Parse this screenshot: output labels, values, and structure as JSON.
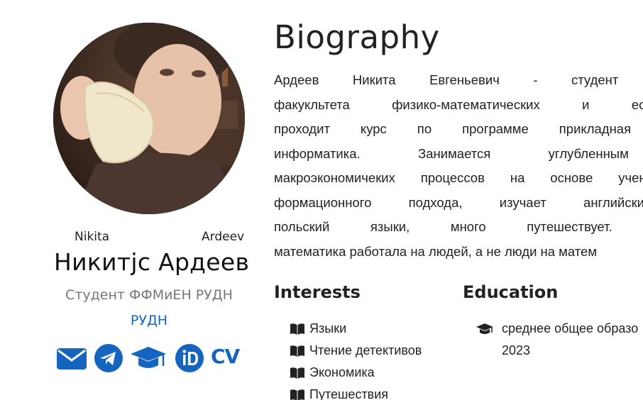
{
  "profile": {
    "first_name": "Nikita",
    "last_name": "Ardeev",
    "full_name": "Никитјс Ардеев",
    "role": "Студент ФФМиЕН РУДН",
    "organization": "РУДН",
    "cv_label": "CV",
    "icons": [
      "envelope-icon",
      "telegram-icon",
      "graduation-cap-icon",
      "orcid-icon"
    ],
    "accent_color": "#1565c0"
  },
  "biography": {
    "title": "Biography",
    "lines": [
      "Ардеев Никита Евгеньевич - студент первого",
      "факукльтета физико-математических и естественн",
      "проходит курс по программе прикладная матем",
      "информатика. Занимается углубленным из",
      "макроэкономичеких процессов на основе учения кл",
      "формационного подхода, изучает английский, н",
      "польский языки, много путешествует. Желает",
      "математика работала на людей, а не люди на матем"
    ]
  },
  "interests": {
    "title": "Interests",
    "items": [
      "Языки",
      "Чтение детективов",
      "Экономика",
      "Путешествия"
    ]
  },
  "education": {
    "title": "Education",
    "course": "среднее общее образо",
    "year": "2023"
  }
}
